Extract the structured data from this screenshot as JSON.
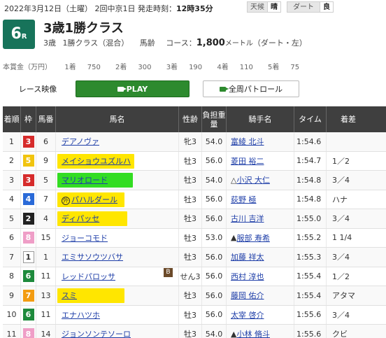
{
  "header": {
    "date_text": "2022年3月12日（土曜） 2回中京1日 発走時刻：",
    "start_time": "12時35分",
    "weather_label": "天候",
    "weather_value": "晴",
    "track_label": "ダート",
    "track_value": "良"
  },
  "race": {
    "number": "6",
    "number_suffix": "R",
    "title": "3歳1勝クラス",
    "age": "3歳",
    "class": "1勝クラス（混合）",
    "weight_rule": "馬齢",
    "course_label": "コース：",
    "distance": "1,800",
    "distance_unit": "メートル",
    "surface": "（ダート・左）"
  },
  "prize": {
    "label": "本賞金（万円）",
    "items": [
      {
        "place": "1着",
        "amount": "750"
      },
      {
        "place": "2着",
        "amount": "300"
      },
      {
        "place": "3着",
        "amount": "190"
      },
      {
        "place": "4着",
        "amount": "110"
      },
      {
        "place": "5着",
        "amount": "75"
      }
    ]
  },
  "controls": {
    "video_label": "レース映像",
    "play_label": "PLAY",
    "patrol_label": "全周パトロール"
  },
  "table": {
    "headers": {
      "rank": "着順",
      "waku": "枠",
      "num": "馬番",
      "horse": "馬名",
      "sex_age": "性齢",
      "weight": "負担重量",
      "jockey": "騎手名",
      "time": "タイム",
      "margin": "着差"
    },
    "rows": [
      {
        "rank": "1",
        "waku": "3",
        "waku_color": "#d62b2b",
        "num": "6",
        "horse": "デアノヴァ",
        "hl": "",
        "sex_age": "牝3",
        "weight": "54.0",
        "jockey_prefix": "",
        "jockey": "富綾 北斗",
        "time": "1:54.6",
        "margin": ""
      },
      {
        "rank": "2",
        "waku": "5",
        "waku_color": "#f1c40f",
        "num": "9",
        "horse": "メイショウユズルハ",
        "hl": "#ffe600",
        "sex_age": "牡3",
        "weight": "56.0",
        "jockey_prefix": "",
        "jockey": "菱田 裕二",
        "time": "1:54.7",
        "margin": "1／2"
      },
      {
        "rank": "3",
        "waku": "3",
        "waku_color": "#d62b2b",
        "num": "5",
        "horse": "マリオロード",
        "hl": "#33dd22",
        "sex_age": "牡3",
        "weight": "54.0",
        "jockey_prefix": "△",
        "jockey": "小沢 大仁",
        "time": "1:54.8",
        "margin": "3／4"
      },
      {
        "rank": "4",
        "waku": "4",
        "waku_color": "#2a6ad8",
        "num": "7",
        "horse": "パハルダール",
        "hl": "#ffe600",
        "mark": "外",
        "sex_age": "牡3",
        "weight": "56.0",
        "jockey_prefix": "",
        "jockey": "荻野 極",
        "time": "1:54.8",
        "margin": "ハナ"
      },
      {
        "rank": "5",
        "waku": "2",
        "waku_color": "#222222",
        "num": "4",
        "horse": "ディパッセ",
        "hl": "#ffe600",
        "sex_age": "牡3",
        "weight": "56.0",
        "jockey_prefix": "",
        "jockey": "古川 吉洋",
        "time": "1:55.0",
        "margin": "3／4"
      },
      {
        "rank": "6",
        "waku": "8",
        "waku_color": "#ef9ec7",
        "num": "15",
        "horse": "ジョーコモド",
        "hl": "",
        "sex_age": "牡3",
        "weight": "53.0",
        "jockey_prefix": "▲",
        "jockey": "服部 寿希",
        "time": "1:55.2",
        "margin": "1 1/4"
      },
      {
        "rank": "7",
        "waku": "1",
        "waku_color": "#ffffff",
        "num": "1",
        "horse": "エミサソウツバサ",
        "hl": "",
        "sex_age": "牡3",
        "weight": "56.0",
        "jockey_prefix": "",
        "jockey": "加藤 祥太",
        "time": "1:55.3",
        "margin": "3／4"
      },
      {
        "rank": "8",
        "waku": "6",
        "waku_color": "#1e8a3c",
        "num": "11",
        "horse": "レッドパロッサ",
        "hl": "",
        "blinker": "B",
        "sex_age": "せん3",
        "weight": "56.0",
        "jockey_prefix": "",
        "jockey": "西村 淳也",
        "time": "1:55.4",
        "margin": "1／2"
      },
      {
        "rank": "9",
        "waku": "7",
        "waku_color": "#f39c12",
        "num": "13",
        "horse": "スミ",
        "hl": "#ffe600",
        "sex_age": "牡3",
        "weight": "56.0",
        "jockey_prefix": "",
        "jockey": "藤岡 佑介",
        "time": "1:55.4",
        "margin": "アタマ"
      },
      {
        "rank": "10",
        "waku": "6",
        "waku_color": "#1e8a3c",
        "num": "11",
        "horse": "エナハツホ",
        "hl": "",
        "sex_age": "牡3",
        "weight": "56.0",
        "jockey_prefix": "",
        "jockey": "太宰 啓介",
        "time": "1:55.6",
        "margin": "3／4"
      },
      {
        "rank": "11",
        "waku": "8",
        "waku_color": "#ef9ec7",
        "num": "14",
        "horse": "ジョンソンテソーロ",
        "hl": "",
        "sex_age": "牡3",
        "weight": "54.0",
        "jockey_prefix": "▲",
        "jockey": "小林 脩斗",
        "time": "1:55.6",
        "margin": "クビ"
      }
    ]
  }
}
